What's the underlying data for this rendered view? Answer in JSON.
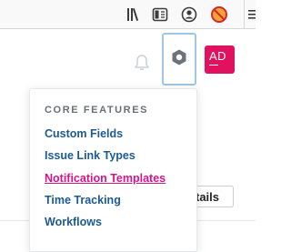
{
  "browser_toolbar": {
    "icons": [
      "library-icon",
      "reader-view-icon",
      "account-icon",
      "blocked-extension-icon",
      "menu-icon"
    ]
  },
  "header": {
    "notification_icon": "bell-icon",
    "settings_icon": "settings-hexagon-icon",
    "avatar_initials": "AD",
    "avatar_color": "#e0115f",
    "accent": "#1c5a93"
  },
  "menu": {
    "heading": "CORE FEATURES",
    "items": [
      {
        "label": "Custom Fields",
        "active": false
      },
      {
        "label": "Issue Link Types",
        "active": false
      },
      {
        "label": "Notification Templates",
        "active": true
      },
      {
        "label": "Time Tracking",
        "active": false
      },
      {
        "label": "Workflows",
        "active": false
      }
    ],
    "active_color": "#d6148a"
  },
  "background": {
    "details_button_label": "tails"
  }
}
